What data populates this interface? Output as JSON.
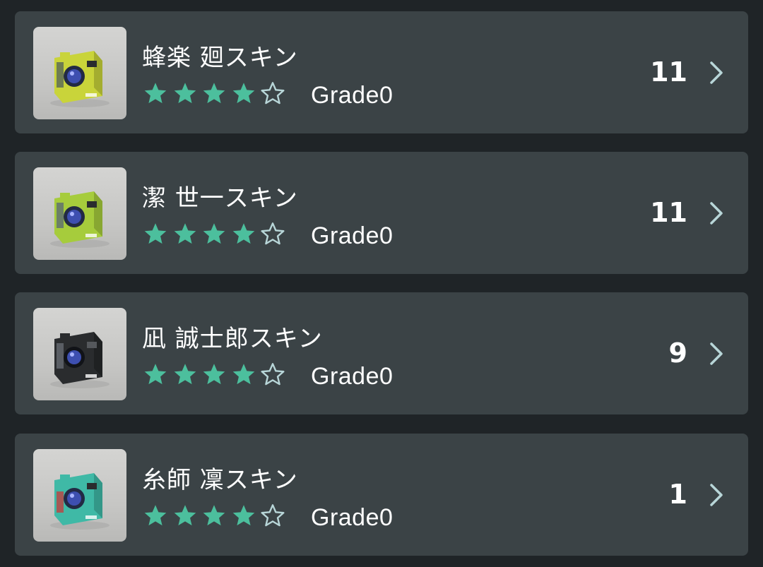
{
  "items": [
    {
      "title": "蜂楽 廻スキン",
      "grade": "Grade0",
      "count": "11",
      "rating": 4,
      "max_rating": 5,
      "camera_color": "#c9d43a",
      "image_icon": "yellow-camera-skin-image"
    },
    {
      "title": "潔 世一スキン",
      "grade": "Grade0",
      "count": "11",
      "rating": 4,
      "max_rating": 5,
      "camera_color": "#a6cc3c",
      "image_icon": "lime-camera-skin-image"
    },
    {
      "title": "凪 誠士郎スキン",
      "grade": "Grade0",
      "count": "9",
      "rating": 4,
      "max_rating": 5,
      "camera_color": "#2a2c2e",
      "image_icon": "black-camera-skin-image"
    },
    {
      "title": "糸師 凜スキン",
      "grade": "Grade0",
      "count": "1",
      "rating": 4,
      "max_rating": 5,
      "camera_color": "#3fb9a6",
      "image_icon": "teal-camera-skin-image"
    }
  ],
  "colors": {
    "background": "#1f2427",
    "card": "#3b4346",
    "star_filled": "#4cbf9d",
    "star_empty_outline": "#b8d6d8",
    "chevron": "#b8d6d8",
    "text": "#ffffff"
  }
}
